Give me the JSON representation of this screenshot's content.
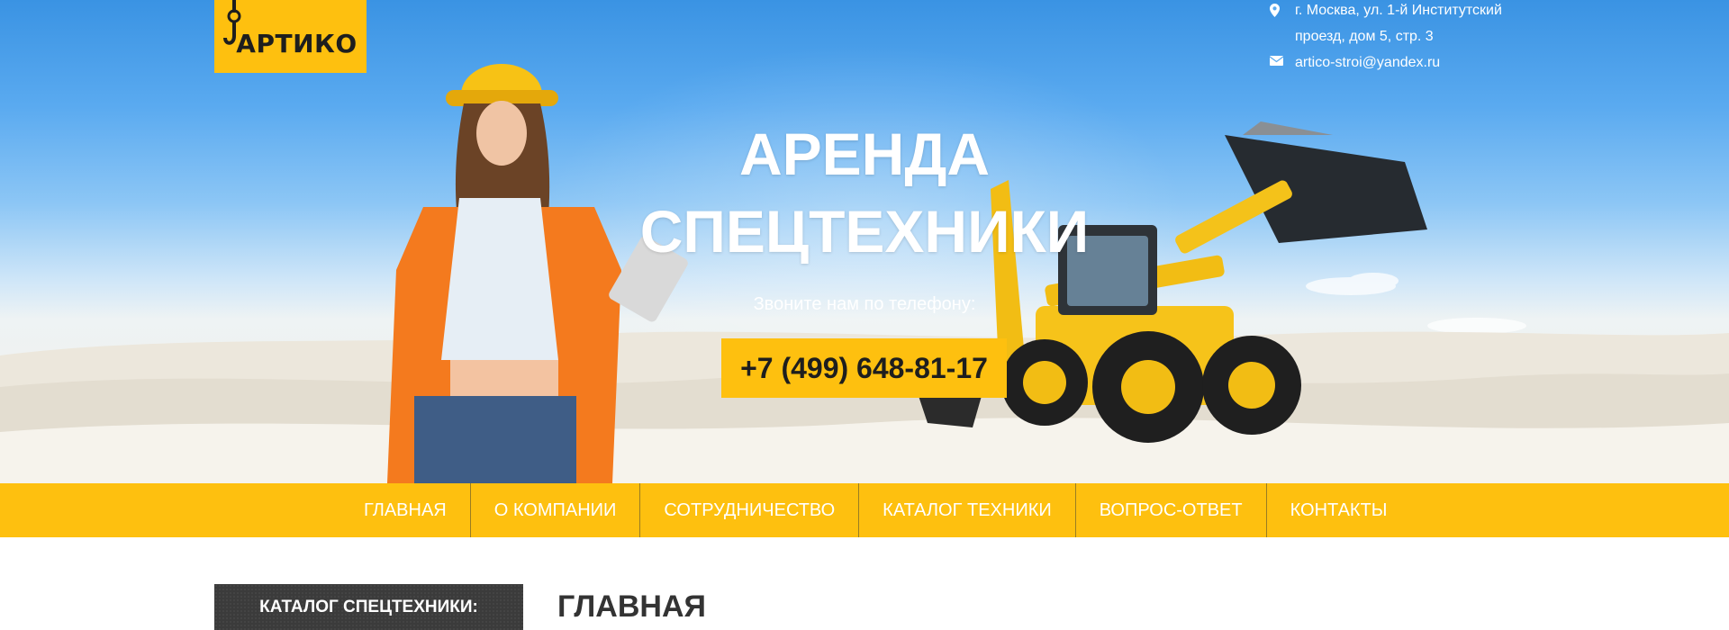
{
  "logo": {
    "text": "АРТИКО"
  },
  "contacts": {
    "address_line1": "г. Москва, ул. 1-й Институтский",
    "address_line2": "проезд, дом 5, стр. 3",
    "email": "artico-stroi@yandex.ru"
  },
  "hero": {
    "headline_line1": "АРЕНДА",
    "headline_line2": "СПЕЦТЕХНИКИ",
    "call_label": "Звоните нам по телефону:",
    "phone": "+7 (499) 648-81-17"
  },
  "nav": {
    "items": [
      "ГЛАВНАЯ",
      "О КОМПАНИИ",
      "СОТРУДНИЧЕСТВО",
      "КАТАЛОГ ТЕХНИКИ",
      "ВОПРОС-ОТВЕТ",
      "КОНТАКТЫ"
    ]
  },
  "sidebar": {
    "catalog_title": "КАТАЛОГ СПЕЦТЕХНИКИ:"
  },
  "main": {
    "page_title": "ГЛАВНАЯ"
  },
  "colors": {
    "accent": "#fec00f",
    "nav_text": "#ffffff",
    "dark": "#3b3b3b"
  }
}
